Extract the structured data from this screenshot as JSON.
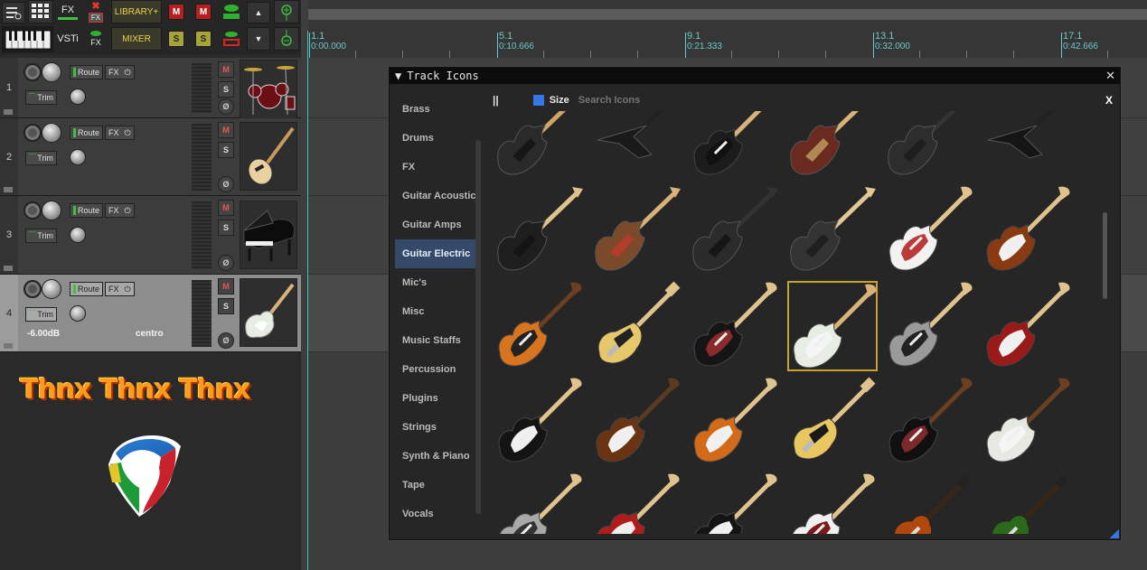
{
  "toolbar": {
    "fx_label": "FX",
    "fx_small": "FX",
    "library": "LIBRARY+",
    "m": "M",
    "m2": "M",
    "vsti": "VSTi",
    "fx2": "FX",
    "mixer": "MIXER",
    "s": "S",
    "s2": "S"
  },
  "tracks": [
    {
      "num": "1",
      "route": "Route",
      "fx": "FX",
      "trim": "Trim",
      "m": "M",
      "s": "S",
      "phase": "Ø",
      "icon": "drums"
    },
    {
      "num": "2",
      "route": "Route",
      "fx": "FX",
      "trim": "Trim",
      "m": "M",
      "s": "S",
      "phase": "Ø",
      "icon": "bass-guitar"
    },
    {
      "num": "3",
      "route": "Route",
      "fx": "FX",
      "trim": "Trim",
      "m": "M",
      "s": "S",
      "phase": "Ø",
      "icon": "grand-piano"
    },
    {
      "num": "4",
      "route": "Route",
      "fx": "FX",
      "trim": "Trim",
      "m": "M",
      "s": "S",
      "phase": "Ø",
      "icon": "electric-guitar",
      "volume": "-6.00dB",
      "pan": "centro"
    }
  ],
  "banner": "Thnx Thnx Thnx",
  "ruler": [
    {
      "bar": "1.1",
      "time": "0:00.000"
    },
    {
      "bar": "5.1",
      "time": "0:10.666"
    },
    {
      "bar": "9.1",
      "time": "0:21.333"
    },
    {
      "bar": "13.1",
      "time": "0:32.000"
    },
    {
      "bar": "17.1",
      "time": "0:42.666"
    }
  ],
  "dialog": {
    "title": "Track Icons",
    "close": "✕",
    "pause": "||",
    "size_label": "Size",
    "search_placeholder": "Search Icons",
    "search_clear": "X",
    "categories": [
      "Brass",
      "Drums",
      "FX",
      "Guitar Acoustic",
      "Guitar Amps",
      "Guitar Electric",
      "Mic's",
      "Misc",
      "Music Staffs",
      "Percussion",
      "Plugins",
      "Strings",
      "Synth & Piano",
      "Tape",
      "Vocals"
    ],
    "active_category": "Guitar Electric"
  },
  "icons": [
    {
      "body": "#2a2a2a",
      "neck": "#cfa56a",
      "guard": "#111",
      "style": "superstrat"
    },
    {
      "body": "#1a1a1a",
      "neck": "#222",
      "guard": "#111",
      "style": "v"
    },
    {
      "body": "#1c1c1c",
      "neck": "#d9b27a",
      "guard": "#111",
      "style": "strat"
    },
    {
      "body": "#6b2a1f",
      "neck": "#d9b27a",
      "guard": "#c2a060",
      "style": "superstrat"
    },
    {
      "body": "#2d2d2d",
      "neck": "#333",
      "guard": "#1a1a1a",
      "style": "superstrat"
    },
    {
      "body": "#151515",
      "neck": "#222",
      "guard": "#111",
      "style": "v"
    },
    {
      "body": "#1e1e1e",
      "neck": "#e0c28c",
      "guard": "#111",
      "style": "superstrat"
    },
    {
      "body": "#7a4a2a",
      "neck": "#d9b27a",
      "guard": "#c23a2a",
      "style": "superstrat"
    },
    {
      "body": "#2b2b2b",
      "neck": "#333",
      "guard": "#111",
      "style": "superstrat"
    },
    {
      "body": "#333",
      "neck": "#e3c796",
      "guard": "#1a1a1a",
      "style": "superstrat"
    },
    {
      "body": "#f2f2f2",
      "neck": "#e0c28c",
      "guard": "#bb3a3a",
      "style": "strat"
    },
    {
      "body": "#8a3a10",
      "neck": "#e0c28c",
      "guard": "#f0f0f0",
      "style": "strat"
    },
    {
      "body": "#d8731e",
      "neck": "#6a3f22",
      "guard": "#222",
      "style": "strat"
    },
    {
      "body": "#e6c76a",
      "neck": "#e0c28c",
      "guard": "#222",
      "style": "tele"
    },
    {
      "body": "#151515",
      "neck": "#e0c28c",
      "guard": "#8a2a2a",
      "style": "strat"
    },
    {
      "body": "#e8ede3",
      "neck": "#d9b27a",
      "guard": "#f5f5f5",
      "style": "strat"
    },
    {
      "body": "#9a9a9a",
      "neck": "#e0c28c",
      "guard": "#222",
      "style": "strat"
    },
    {
      "body": "#9a1a1a",
      "neck": "#e0c28c",
      "guard": "#f0f0f0",
      "style": "strat"
    },
    {
      "body": "#141414",
      "neck": "#e0c28c",
      "guard": "#f0f0f0",
      "style": "strat"
    },
    {
      "body": "#6a3412",
      "neck": "#5a3a20",
      "guard": "#f0f0f0",
      "style": "strat"
    },
    {
      "body": "#d26a1a",
      "neck": "#e0c28c",
      "guard": "#f0f0f0",
      "style": "strat"
    },
    {
      "body": "#e8c660",
      "neck": "#e0c28c",
      "guard": "#1a1a1a",
      "style": "tele"
    },
    {
      "body": "#101010",
      "neck": "#6a3f22",
      "guard": "#7a2a2a",
      "style": "strat"
    },
    {
      "body": "#e6e9e2",
      "neck": "#6a3f22",
      "guard": "#f5f5f5",
      "style": "strat"
    },
    {
      "body": "#a8a8a8",
      "neck": "#e0c28c",
      "guard": "#333",
      "style": "strat"
    },
    {
      "body": "#b01c1c",
      "neck": "#e0c28c",
      "guard": "#f0f0f0",
      "style": "strat"
    },
    {
      "body": "#141414",
      "neck": "#e0c28c",
      "guard": "#f0f0f0",
      "style": "strat"
    },
    {
      "body": "#f0f0f0",
      "neck": "#e0c28c",
      "guard": "#7a1a1a",
      "style": "strat"
    },
    {
      "body": "#b0480e",
      "neck": "#3a2614",
      "guard": "#111",
      "style": "lp"
    },
    {
      "body": "#2a6a1a",
      "neck": "#3a2614",
      "guard": "#111",
      "style": "lp"
    }
  ],
  "selected_icon": 15
}
